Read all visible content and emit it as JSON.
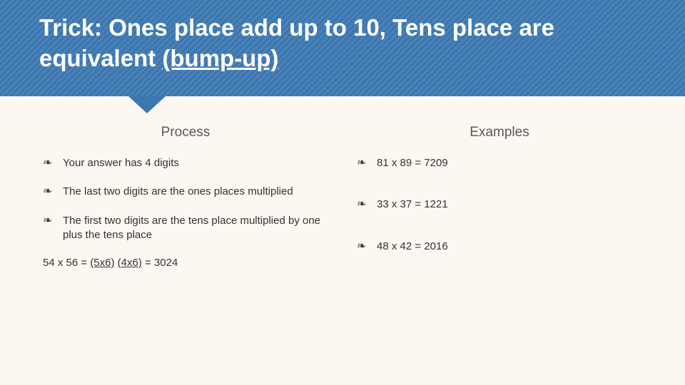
{
  "header": {
    "title_part1": "Trick: Ones place add up to 10, Tens place are equivalent ",
    "title_underlined": "(bump-up)"
  },
  "process": {
    "heading": "Process",
    "items": [
      "Your answer has 4 digits",
      "The last two digits are the ones places multiplied",
      "The first two digits are the tens place multiplied by one plus the tens place"
    ],
    "worked_prefix": "54 x 56 = ",
    "worked_group1": "(5x6)",
    "worked_mid": " ",
    "worked_group2": "(4x6)",
    "worked_suffix": " = 3024"
  },
  "examples": {
    "heading": "Examples",
    "items": [
      "81 x 89 = 7209",
      "33 x 37 = 1221",
      "48 x 42 = 2016"
    ]
  }
}
